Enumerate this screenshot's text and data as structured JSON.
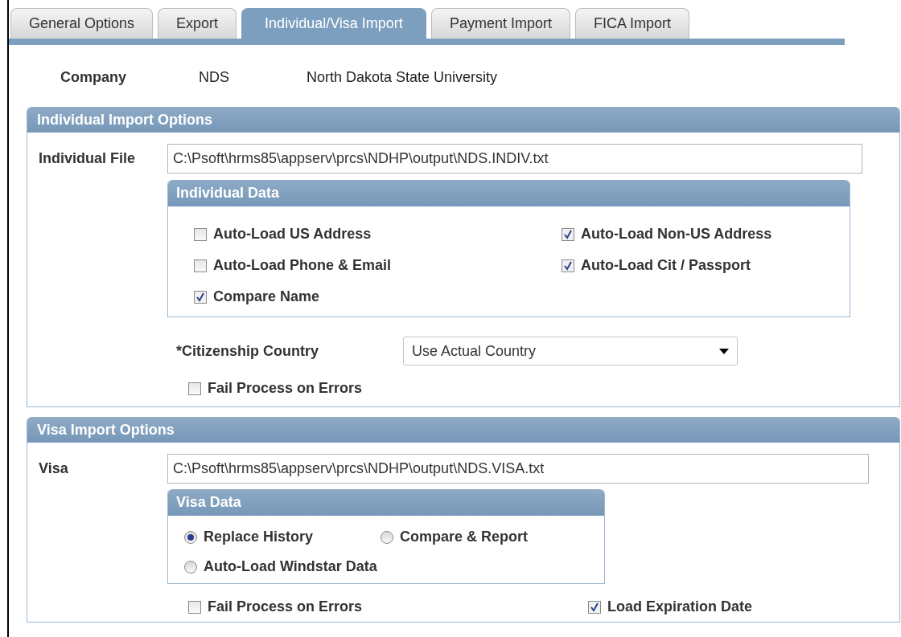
{
  "tabs": [
    {
      "label": "General Options",
      "selected": false
    },
    {
      "label": "Export",
      "selected": false
    },
    {
      "label": "Individual/Visa Import",
      "selected": true
    },
    {
      "label": "Payment Import",
      "selected": false
    },
    {
      "label": "FICA Import",
      "selected": false
    }
  ],
  "company": {
    "label": "Company",
    "code": "NDS",
    "name": "North Dakota State University"
  },
  "individual_section": {
    "title": "Individual Import Options",
    "file_label": "Individual File",
    "file_value": "C:\\Psoft\\hrms85\\appserv\\prcs\\NDHP\\output\\NDS.INDIV.txt",
    "group_title": "Individual Data",
    "options": [
      {
        "label": "Auto-Load US Address",
        "checked": false
      },
      {
        "label": "Auto-Load Non-US Address",
        "checked": true
      },
      {
        "label": "Auto-Load Phone & Email",
        "checked": false
      },
      {
        "label": "Auto-Load Cit / Passport",
        "checked": true
      },
      {
        "label": "Compare Name",
        "checked": true
      }
    ],
    "citizenship_label": "*Citizenship Country",
    "citizenship_value": "Use Actual Country",
    "fail_on_errors": {
      "label": "Fail Process on Errors",
      "checked": false
    }
  },
  "visa_section": {
    "title": "Visa Import Options",
    "file_label": "Visa",
    "file_value": "C:\\Psoft\\hrms85\\appserv\\prcs\\NDHP\\output\\NDS.VISA.txt",
    "group_title": "Visa Data",
    "modes": [
      {
        "label": "Replace History",
        "selected": true
      },
      {
        "label": "Compare & Report",
        "selected": false
      },
      {
        "label": "Auto-Load Windstar Data",
        "selected": false
      }
    ],
    "fail_on_errors": {
      "label": "Fail Process on Errors",
      "checked": false
    },
    "load_expiration": {
      "label": "Load Expiration Date",
      "checked": true
    }
  }
}
